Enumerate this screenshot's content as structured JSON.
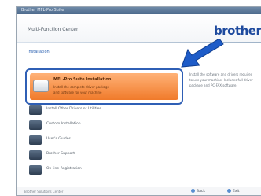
{
  "window": {
    "title": "Brother MFL-Pro Suite"
  },
  "header": {
    "title": "Multi-Function Center",
    "brand": "brother"
  },
  "section": {
    "heading": "Installation"
  },
  "highlighted_item": {
    "label": "MFL-Pro Suite Installation",
    "sub1": "Install the complete driver package",
    "sub2": "and software for your machine"
  },
  "description": "Install the software and drivers required to use your machine. Includes full driver package and PC-FAX software.",
  "items": [
    {
      "label": "Install Other Drivers or Utilities"
    },
    {
      "label": "Custom Installation"
    },
    {
      "label": "User's Guides"
    },
    {
      "label": "Brother Support"
    },
    {
      "label": "On-line Registration"
    }
  ],
  "footer": {
    "left_text": "Brother Solutions Center",
    "back_label": "Back",
    "exit_label": "Exit"
  },
  "colors": {
    "accent": "#2f5fb5",
    "highlight": "#f07a2a",
    "brand": "#1e4a9e"
  },
  "icons": {
    "arrow": "arrow-pointer-icon"
  }
}
